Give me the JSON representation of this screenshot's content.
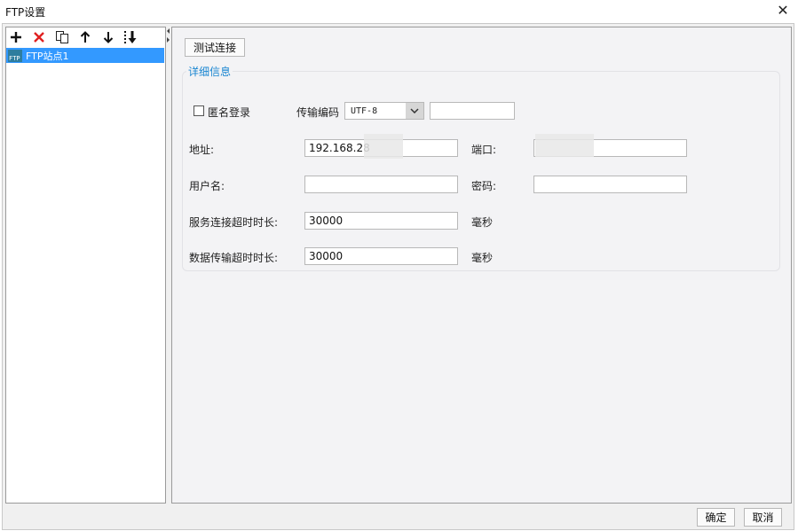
{
  "window": {
    "title": "FTP设置",
    "close_glyph": "✕"
  },
  "toolbar": {
    "icons": [
      "add-icon",
      "delete-icon",
      "copy-icon",
      "move-up-icon",
      "move-down-icon",
      "sort-icon"
    ]
  },
  "tree": {
    "items": [
      {
        "label": "FTP站点1",
        "icon_text": "FTP"
      }
    ]
  },
  "main": {
    "test_button": "测试连接",
    "section_title": "详细信息",
    "anonymous_label": "匿名登录",
    "anonymous_checked": false,
    "encoding_label": "传输编码",
    "encoding_value": "UTF-8",
    "encoding_extra": "",
    "address_label": "地址:",
    "address_value": "192.168.28",
    "port_label": "端口:",
    "port_value": "",
    "username_label": "用户名:",
    "username_value": "",
    "password_label": "密码:",
    "password_value": "",
    "conn_timeout_label": "服务连接超时时长:",
    "conn_timeout_value": "30000",
    "conn_timeout_unit": "毫秒",
    "data_timeout_label": "数据传输超时时长:",
    "data_timeout_value": "30000",
    "data_timeout_unit": "毫秒"
  },
  "footer": {
    "ok": "确定",
    "cancel": "取消"
  },
  "colors": {
    "selection": "#3399ff",
    "accent": "#1a86d1",
    "delete": "#e02020"
  }
}
